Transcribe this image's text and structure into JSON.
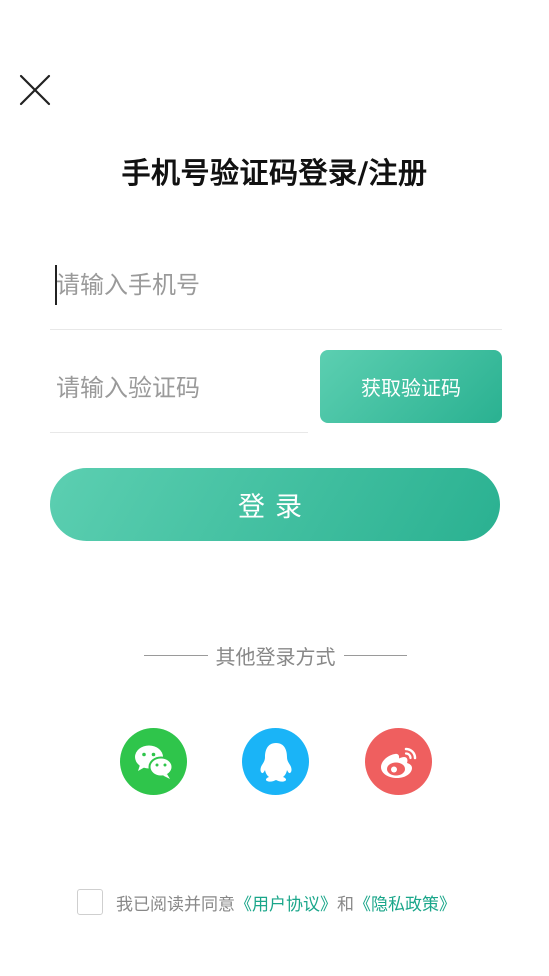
{
  "header": {
    "title": "手机号验证码登录/注册"
  },
  "form": {
    "phone_placeholder": "请输入手机号",
    "code_placeholder": "请输入验证码",
    "get_code_label": "获取验证码",
    "login_label": "登录"
  },
  "other_login": {
    "label": "其他登录方式",
    "providers": [
      "wechat-icon",
      "qq-icon",
      "weibo-icon"
    ]
  },
  "agreement": {
    "prefix": "我已阅读并同意",
    "user_agreement": "《用户协议》",
    "and": "和",
    "privacy_policy": "《隐私政策》",
    "checked": false
  },
  "colors": {
    "accent_start": "#5ccfb1",
    "accent_end": "#2ab191",
    "link": "#1aa68a",
    "wechat": "#2fc54b",
    "qq": "#1ab4f7",
    "weibo": "#ef5f5f"
  }
}
